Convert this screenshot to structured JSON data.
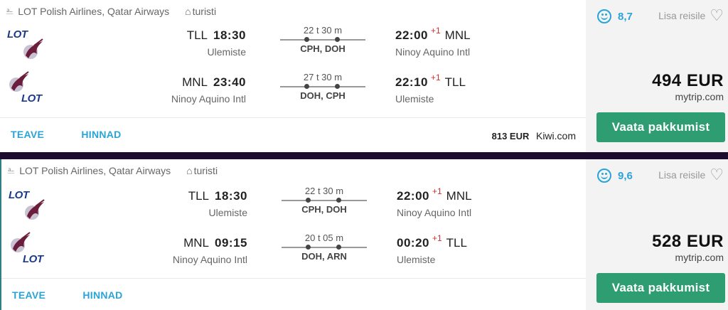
{
  "results": [
    {
      "airlines": "LOT Polish Airlines, Qatar Airways",
      "cabin": "turisti",
      "legs": [
        {
          "dep_code": "TLL",
          "dep_time": "18:30",
          "dep_airport": "Ulemiste",
          "duration": "22 t 30 m",
          "stops": "CPH, DOH",
          "arr_time": "22:00",
          "day_offset": "+1",
          "arr_code": "MNL",
          "arr_airport": "Ninoy Aquino Intl",
          "first_airline": "LOT"
        },
        {
          "dep_code": "MNL",
          "dep_time": "23:40",
          "dep_airport": "Ninoy Aquino Intl",
          "duration": "27 t 30 m",
          "stops": "DOH, CPH",
          "arr_time": "22:10",
          "day_offset": "+1",
          "arr_code": "TLL",
          "arr_airport": "Ulemiste",
          "first_airline": "Qatar"
        }
      ],
      "links": {
        "info": "TEAVE",
        "prices": "HINNAD"
      },
      "alt_price": "813 EUR",
      "alt_source": "Kiwi.com",
      "score": "8,7",
      "save_label": "Lisa reisile",
      "price": "494 EUR",
      "price_source": "mytrip.com",
      "cta": "Vaata pakkumist"
    },
    {
      "airlines": "LOT Polish Airlines, Qatar Airways",
      "cabin": "turisti",
      "legs": [
        {
          "dep_code": "TLL",
          "dep_time": "18:30",
          "dep_airport": "Ulemiste",
          "duration": "22 t 30 m",
          "stops": "CPH, DOH",
          "arr_time": "22:00",
          "day_offset": "+1",
          "arr_code": "MNL",
          "arr_airport": "Ninoy Aquino Intl",
          "first_airline": "LOT"
        },
        {
          "dep_code": "MNL",
          "dep_time": "09:15",
          "dep_airport": "Ninoy Aquino Intl",
          "duration": "20 t 05 m",
          "stops": "DOH, ARN",
          "arr_time": "00:20",
          "day_offset": "+1",
          "arr_code": "TLL",
          "arr_airport": "Ulemiste",
          "first_airline": "Qatar"
        }
      ],
      "links": {
        "info": "TEAVE",
        "prices": "HINNAD"
      },
      "alt_price": "",
      "alt_source": "",
      "score": "9,6",
      "save_label": "Lisa reisile",
      "price": "528 EUR",
      "price_source": "mytrip.com",
      "cta": "Vaata pakkumist"
    }
  ],
  "logos": {
    "lot_text": "LOT"
  },
  "colors": {
    "accent": "#2aa4d8",
    "cta": "#2e9d72",
    "day_offset": "#d6302f",
    "separator": "#1d0b2e"
  }
}
